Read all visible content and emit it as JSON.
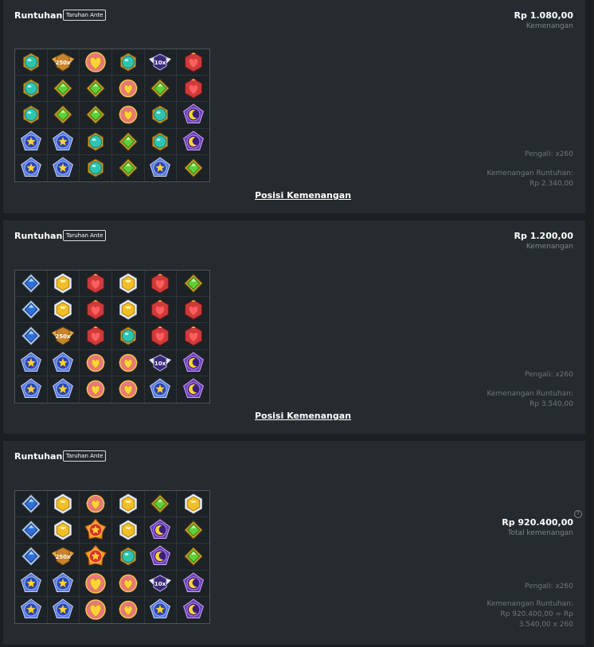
{
  "colors": {
    "background": "#1b1f22",
    "panel": "#252b2f",
    "muted": "#7b858b"
  },
  "labels": {
    "runtuhan": "Runtuhan",
    "ante": "Taruhan Ante",
    "kemenangan": "Kemenangan",
    "pengali": "Pengali: x260",
    "runtuhan_win": "Kemenangan Runtuhan:",
    "posisi": "Posisi Kemenangan",
    "total": "Total kemenangan",
    "help": "?"
  },
  "panels": [
    {
      "amount": "Rp 1.080,00",
      "runtuhan_value": "Rp 2.340,00",
      "grid": [
        [
          "teal",
          "mult250",
          "heart",
          "teal",
          "mult10",
          "red"
        ],
        [
          "teal",
          "green",
          "green",
          "heartwing",
          "green",
          "red"
        ],
        [
          "teal",
          "green",
          "green",
          "heartwing",
          "teal",
          "moon"
        ],
        [
          "star",
          "star",
          "teal",
          "green",
          "teal",
          "moon"
        ],
        [
          "star",
          "star",
          "teal",
          "green",
          "star",
          "green"
        ]
      ]
    },
    {
      "amount": "Rp 1.200,00",
      "runtuhan_value": "Rp 3.540,00",
      "grid": [
        [
          "blue",
          "yellow",
          "red",
          "yellow",
          "red",
          "green"
        ],
        [
          "blue",
          "yellow",
          "red",
          "yellow",
          "red",
          "red"
        ],
        [
          "blue",
          "mult250",
          "red",
          "teal",
          "red",
          "red"
        ],
        [
          "star",
          "star",
          "heartwing",
          "heartwing",
          "mult10",
          "moon"
        ],
        [
          "star",
          "star",
          "heartwing",
          "heartwing",
          "star",
          "moon"
        ]
      ]
    },
    {
      "amount": "Rp 920.400,00",
      "runtuhan_line1": "Rp 920.400,00 = Rp",
      "runtuhan_line2": "3.540,00 x 260",
      "grid": [
        [
          "blue",
          "yellow",
          "heartwing",
          "yellow",
          "green",
          "yellow"
        ],
        [
          "blue",
          "yellow",
          "sun",
          "yellow",
          "moon",
          "green"
        ],
        [
          "blue",
          "mult250",
          "sun",
          "teal",
          "moon",
          "green"
        ],
        [
          "star",
          "star",
          "heart",
          "heartwing",
          "mult10",
          "moon"
        ],
        [
          "star",
          "star",
          "heart",
          "heartwing",
          "star",
          "moon"
        ]
      ]
    }
  ]
}
